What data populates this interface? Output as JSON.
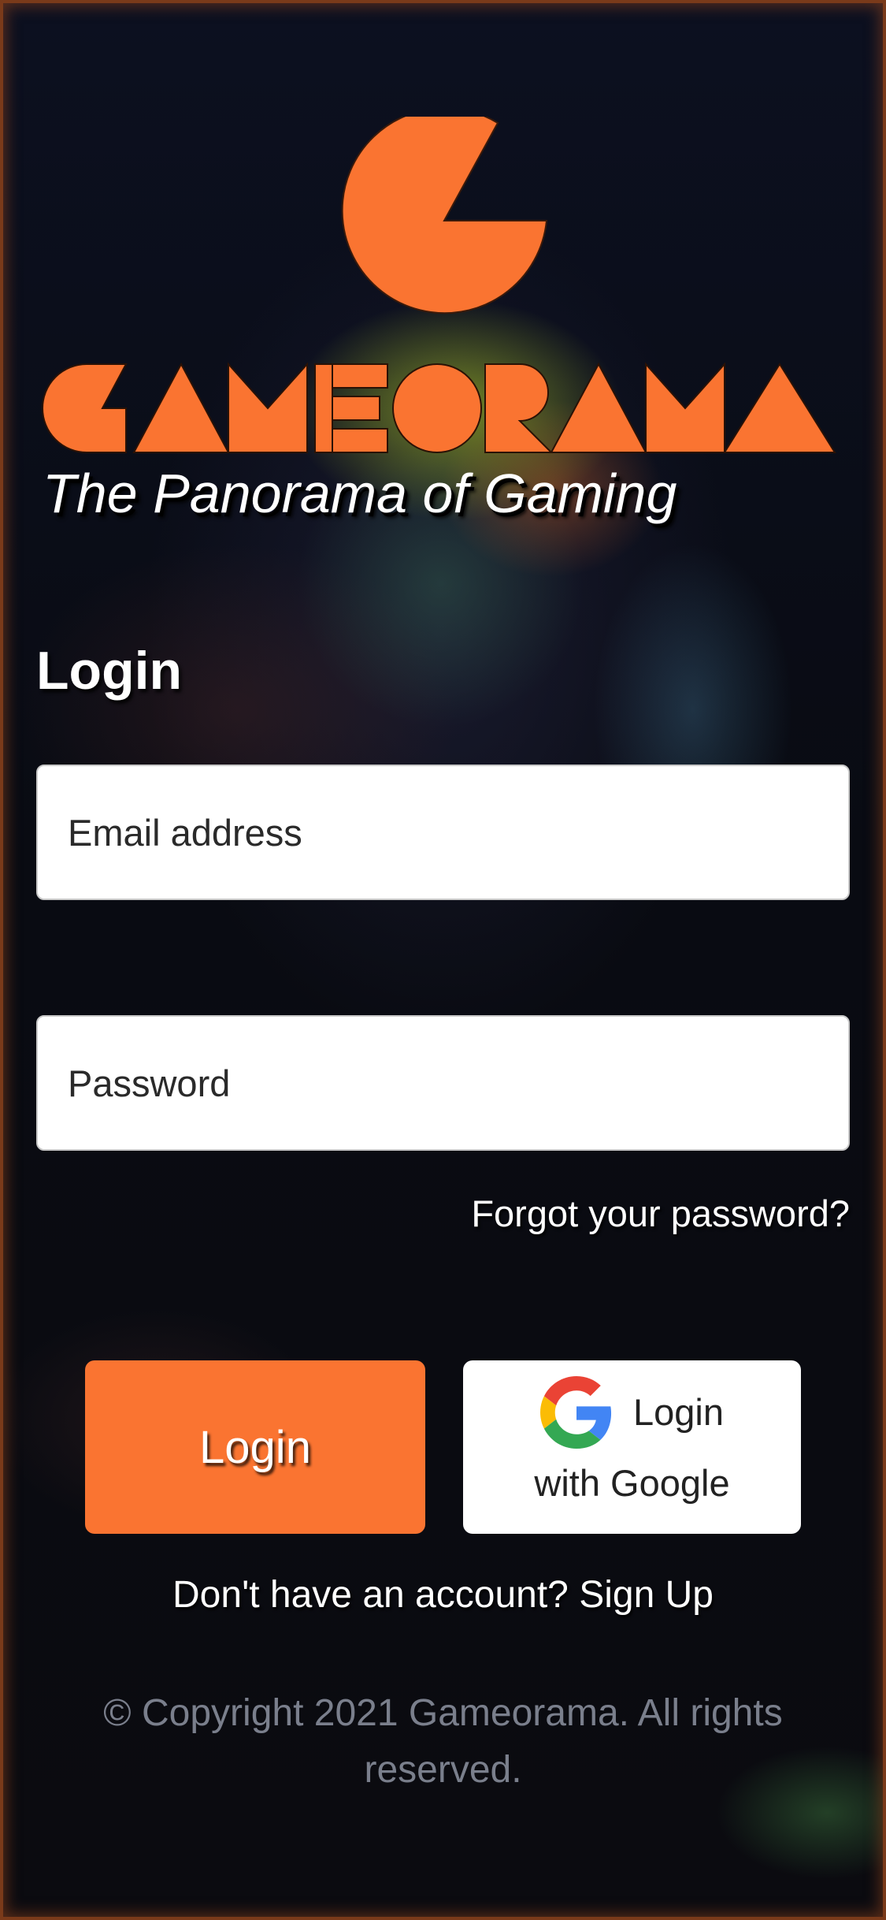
{
  "brand": {
    "name": "GAMEORAMA",
    "tagline": "The Panorama of Gaming",
    "accent_color": "#fa7431"
  },
  "login_form": {
    "title": "Login",
    "email_placeholder": "Email address",
    "password_placeholder": "Password",
    "forgot_link": "Forgot your password?",
    "login_button": "Login",
    "google_button_line1": "Login",
    "google_button_line2": "with Google",
    "google_icon": "google-g-icon"
  },
  "signup": {
    "prompt": "Don't have an account?",
    "link": "Sign Up"
  },
  "footer": {
    "copyright": "© Copyright 2021 Gameorama. All rights reserved."
  }
}
